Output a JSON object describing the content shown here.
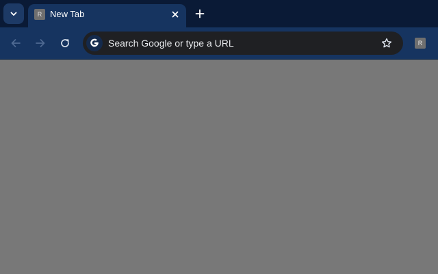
{
  "tab_strip": {
    "search_tabs_icon": "chevron-down-icon",
    "active_tab": {
      "favicon_letter": "R",
      "title": "New Tab",
      "close_icon": "close-icon"
    },
    "new_tab_icon": "plus-icon"
  },
  "toolbar": {
    "back_icon": "arrow-left-icon",
    "forward_icon": "arrow-right-icon",
    "reload_icon": "reload-icon",
    "omnibox": {
      "search_engine_icon": "google-g-icon",
      "placeholder": "Search Google or type a URL",
      "bookmark_icon": "star-icon"
    },
    "profile_letter": "R"
  },
  "colors": {
    "tabstrip_bg": "#0a1a36",
    "toolbar_bg": "#163460",
    "omnibox_bg": "#1f2023",
    "content_bg": "#787878"
  }
}
